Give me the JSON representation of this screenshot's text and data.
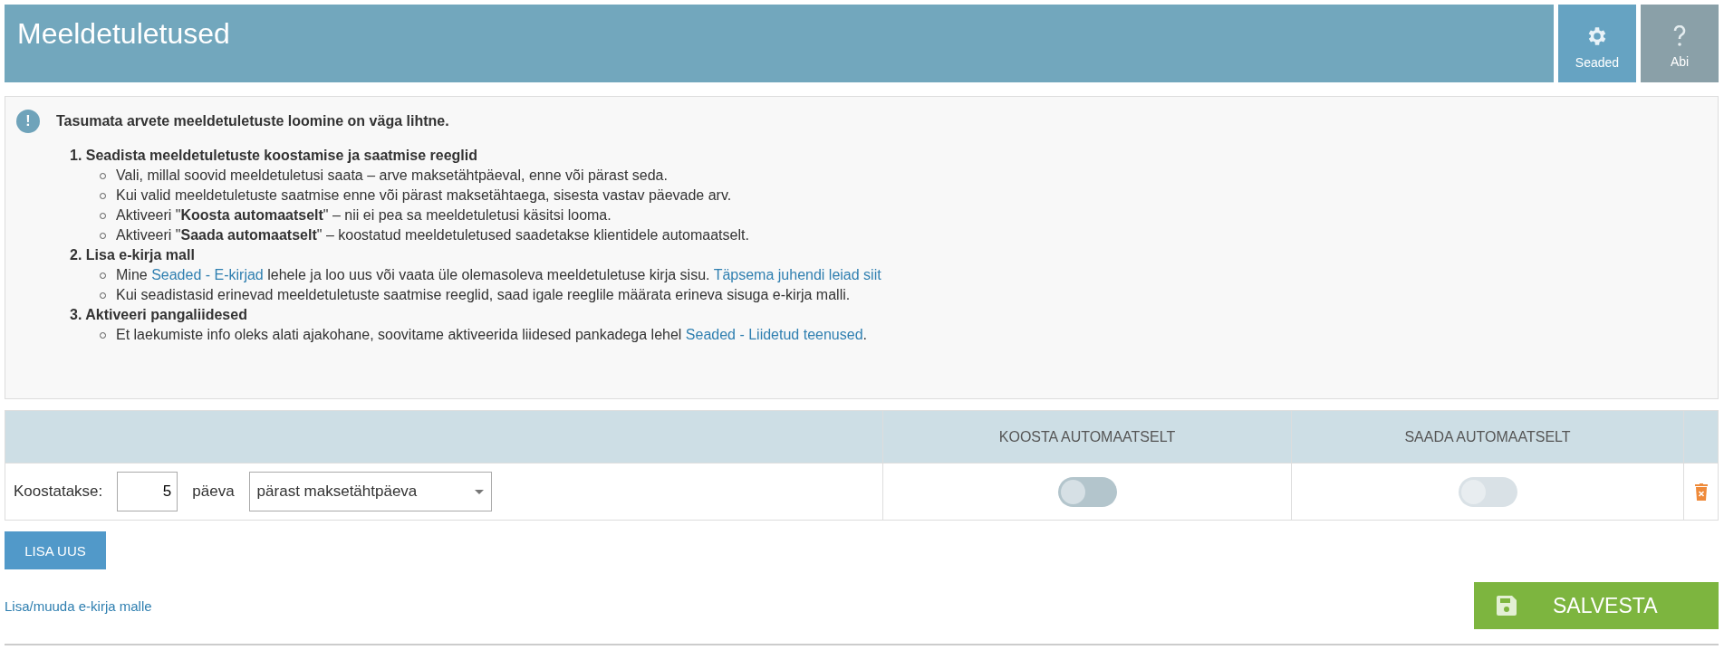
{
  "header": {
    "title": "Meeldetuletused",
    "buttons": [
      {
        "label": "Seaded",
        "kind": "settings"
      },
      {
        "label": "Abi",
        "kind": "help"
      }
    ]
  },
  "info": {
    "icon": "!",
    "heading": "Tasumata arvete meeldetuletuste loomine on väga lihtne.",
    "steps": [
      {
        "number": "1.",
        "title": "Seadista meeldetuletuste koostamise ja saatmise reeglid",
        "bullets": [
          [
            {
              "kind": "text",
              "text": "Vali, millal soovid meeldetuletusi saata – arve maksetähtpäeval, enne või pärast seda."
            }
          ],
          [
            {
              "kind": "text",
              "text": "Kui valid meeldetuletuste saatmise enne või pärast maksetähtaega, sisesta vastav päevade arv."
            }
          ],
          [
            {
              "kind": "text",
              "text": "Aktiveeri \"**Koosta automaatselt**\" – nii ei pea sa meeldetuletusi käsitsi looma."
            }
          ],
          [
            {
              "kind": "text",
              "text": "Aktiveeri \"**Saada automaatselt**\" – koostatud meeldetuletused saadetakse klientidele automaatselt."
            }
          ]
        ]
      },
      {
        "number": "2.",
        "title": "Lisa e-kirja mall",
        "bullets": [
          [
            {
              "kind": "text",
              "text": "Mine "
            },
            {
              "kind": "link",
              "text": "Seaded - E-kirjad"
            },
            {
              "kind": "text",
              "text": " lehele ja loo uus või vaata üle olemasoleva meeldetuletuse kirja sisu. "
            },
            {
              "kind": "link",
              "text": "Täpsema juhendi leiad siit"
            }
          ],
          [
            {
              "kind": "text",
              "text": "Kui seadistasid erinevad meeldetuletuste saatmise reeglid, saad igale reeglile määrata erineva sisuga e-kirja malli."
            }
          ]
        ]
      },
      {
        "number": "3.",
        "title": "Aktiveeri pangaliidesed",
        "bullets": [
          [
            {
              "kind": "text",
              "text": "Et laekumiste info oleks alati ajakohane, soovitame aktiveerida liidesed pankadega lehel "
            },
            {
              "kind": "link",
              "text": "Seaded - Liidetud teenused"
            },
            {
              "kind": "text",
              "text": "."
            }
          ]
        ]
      }
    ]
  },
  "table": {
    "columns": [
      "KOOSTA AUTOMAATSELT",
      "SAADA AUTOMAATSELT"
    ],
    "rows": [
      {
        "label": "Koostatakse:",
        "days": "5",
        "unit": "päeva",
        "timing": "pärast maksetähtpäeva",
        "auto_create": {
          "on": false,
          "disabled": false
        },
        "auto_send": {
          "on": false,
          "disabled": true
        }
      }
    ]
  },
  "add_button": "LISA UUS",
  "templates_link": "Lisa/muuda e-kirja malle",
  "save_button": "SALVESTA"
}
